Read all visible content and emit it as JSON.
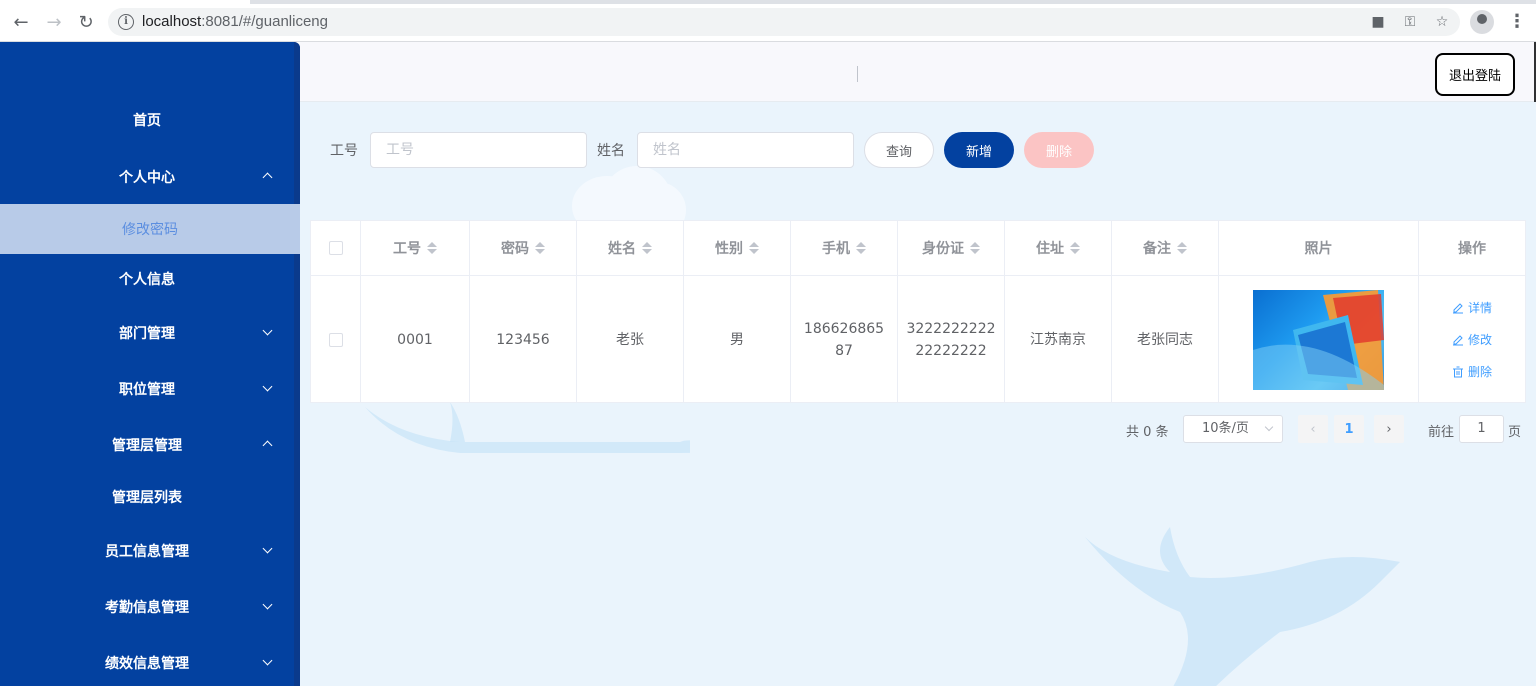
{
  "browser": {
    "url_host": "localhost",
    "url_path": ":8081/#/guanliceng"
  },
  "sidebar": {
    "items": [
      {
        "label": "首页"
      },
      {
        "label": "个人中心"
      },
      {
        "label": "修改密码"
      },
      {
        "label": "个人信息"
      },
      {
        "label": "部门管理"
      },
      {
        "label": "职位管理"
      },
      {
        "label": "管理层管理"
      },
      {
        "label": "管理层列表"
      },
      {
        "label": "员工信息管理"
      },
      {
        "label": "考勤信息管理"
      },
      {
        "label": "绩效信息管理"
      }
    ]
  },
  "header": {
    "logout_label": "退出登陆"
  },
  "search": {
    "id_label": "工号",
    "id_placeholder": "工号",
    "name_label": "姓名",
    "name_placeholder": "姓名",
    "query_label": "查询",
    "add_label": "新增",
    "delete_label": "删除"
  },
  "table": {
    "columns": [
      "工号",
      "密码",
      "姓名",
      "性别",
      "手机",
      "身份证",
      "住址",
      "备注",
      "照片",
      "操作"
    ],
    "rows": [
      {
        "id": "0001",
        "password": "123456",
        "name": "老张",
        "gender": "男",
        "phone": "18662686587",
        "idcard": "322222222222222222",
        "address": "江苏南京",
        "remark": "老张同志"
      }
    ],
    "actions": {
      "detail": "详情",
      "edit": "修改",
      "delete": "删除"
    }
  },
  "pagination": {
    "total": "共 0 条",
    "page_size": "10条/页",
    "current_page": "1",
    "goto_label": "前往",
    "goto_value": "1",
    "page_suffix": "页"
  },
  "colors": {
    "sidebar_bg": "#0341a0",
    "primary": "#0341a0",
    "link": "#409eff",
    "danger_disabled": "#fbc4c4",
    "main_bg": "#eaf4fc"
  }
}
